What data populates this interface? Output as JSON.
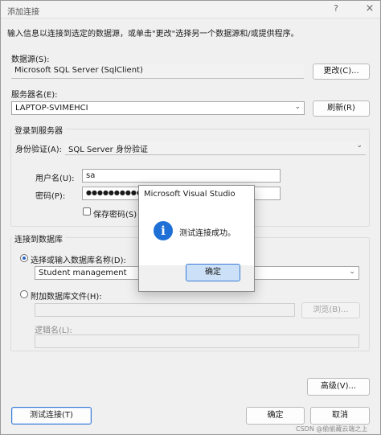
{
  "window": {
    "title": "添加连接",
    "help_icon": "help-icon",
    "close_icon": "close-icon",
    "help_glyph": "?",
    "close_glyph": "×"
  },
  "intro_text": "输入信息以连接到选定的数据源，或单击\"更改\"选择另一个数据源和/或提供程序。",
  "datasource": {
    "label": "数据源(S):",
    "value": "Microsoft SQL Server (SqlClient)",
    "change_button": "更改(C)..."
  },
  "server": {
    "label": "服务器名(E):",
    "value": "LAPTOP-SVIMEHCI",
    "refresh_button": "刷新(R)"
  },
  "login": {
    "group_title": "登录到服务器",
    "auth_label": "身份验证(A):",
    "auth_value": "SQL Server 身份验证",
    "username_label": "用户名(U):",
    "username_value": "sa",
    "password_label": "密码(P):",
    "password_value": "●●●●●●●●●●●",
    "save_password_label": "保存密码(S)"
  },
  "database": {
    "group_title": "连接到数据库",
    "select_option_label": "选择或输入数据库名称(D):",
    "select_value": "Student management",
    "attach_option_label": "附加数据库文件(H):",
    "attach_value": "",
    "browse_button": "浏览(B)...",
    "logical_name_label": "逻辑名(L):",
    "logical_name_value": ""
  },
  "advanced_button": "高级(V)...",
  "test_button": "测试连接(T)",
  "ok_button": "确定",
  "cancel_button": "取消",
  "modal": {
    "title": "Microsoft Visual Studio",
    "icon": "info-icon",
    "icon_glyph": "i",
    "message": "测试连接成功。",
    "ok_button": "确定"
  },
  "dropdown_glyph": "⌄",
  "watermark": "CSDN @偷偷藏云端之上"
}
